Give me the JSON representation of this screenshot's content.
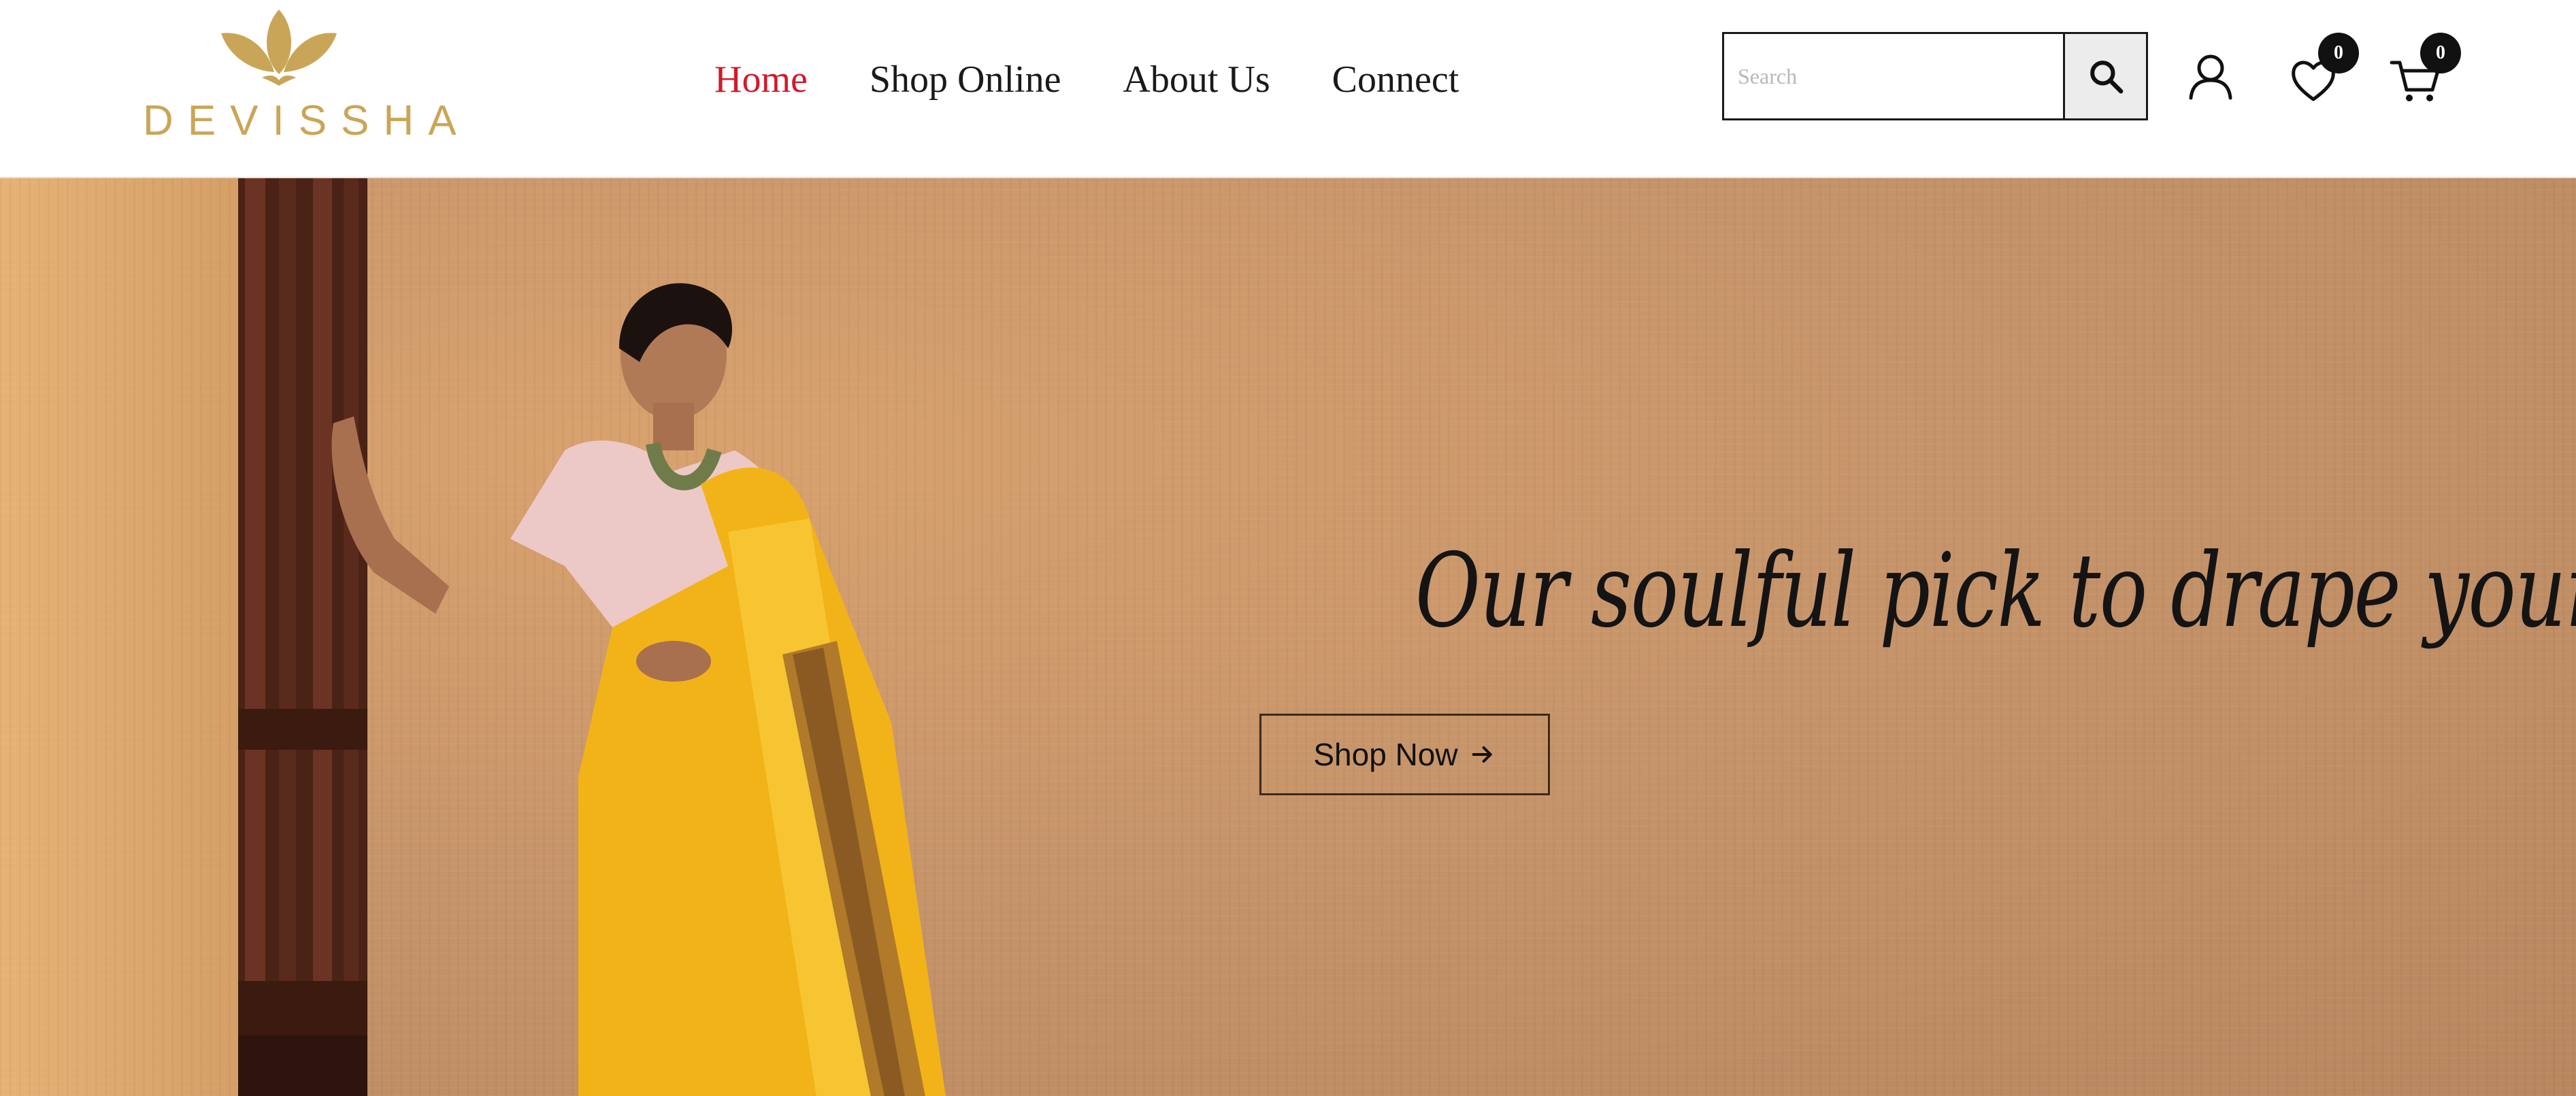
{
  "brand": {
    "name": "DEVISSHA",
    "logo_color": "#c9a657"
  },
  "nav": {
    "items": [
      {
        "label": "Home",
        "active": true
      },
      {
        "label": "Shop Online",
        "active": false
      },
      {
        "label": "About Us",
        "active": false
      },
      {
        "label": "Connect",
        "active": false
      }
    ],
    "active_color": "#d11a2a"
  },
  "search": {
    "placeholder": "Search",
    "value": "",
    "icon": "search-icon"
  },
  "header_icons": {
    "account": {
      "icon": "user-icon"
    },
    "wishlist": {
      "icon": "heart-icon",
      "count": "0"
    },
    "cart": {
      "icon": "cart-icon",
      "count": "0"
    }
  },
  "hero": {
    "tagline": "Our soulful pick to drape your heart",
    "cta_label": "Shop Now",
    "cta_icon": "arrow-right-icon",
    "background_color": "#c7956b"
  }
}
